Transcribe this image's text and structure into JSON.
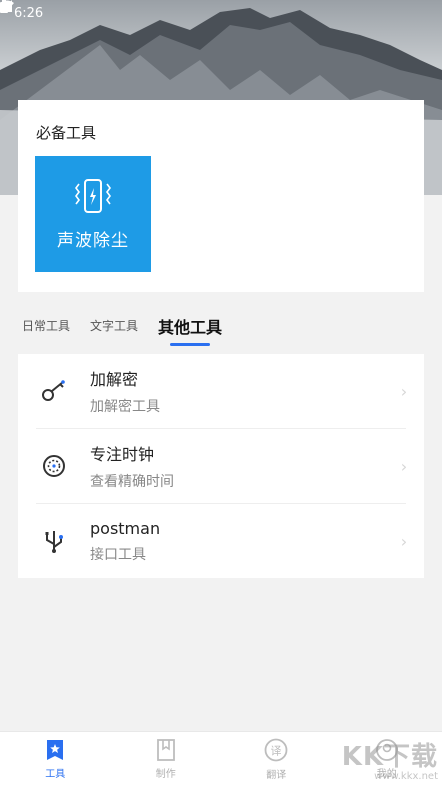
{
  "status_bar": {
    "time": "6:26"
  },
  "top_card": {
    "title": "必备工具",
    "tile_label": "声波除尘",
    "tile_color": "#1e9be6"
  },
  "tabs": [
    {
      "label": "日常工具",
      "active": false
    },
    {
      "label": "文字工具",
      "active": false
    },
    {
      "label": "其他工具",
      "active": true
    }
  ],
  "tools": [
    {
      "name": "加解密",
      "desc": "加解密工具",
      "icon": "key-icon"
    },
    {
      "name": "专注时钟",
      "desc": "查看精确时间",
      "icon": "clock-icon"
    },
    {
      "name": "postman",
      "desc": "接口工具",
      "icon": "usb-icon"
    }
  ],
  "bottom_nav": [
    {
      "label": "工具",
      "icon": "tools-star-icon",
      "active": true
    },
    {
      "label": "制作",
      "icon": "bookmark-icon",
      "active": false
    },
    {
      "label": "翻译",
      "icon": "translate-icon",
      "active": false
    },
    {
      "label": "我的",
      "icon": "profile-icon",
      "active": false
    }
  ],
  "watermark": {
    "main": "KK下载",
    "sub": "www.kkx.net"
  },
  "accent_color": "#2a6ff0"
}
